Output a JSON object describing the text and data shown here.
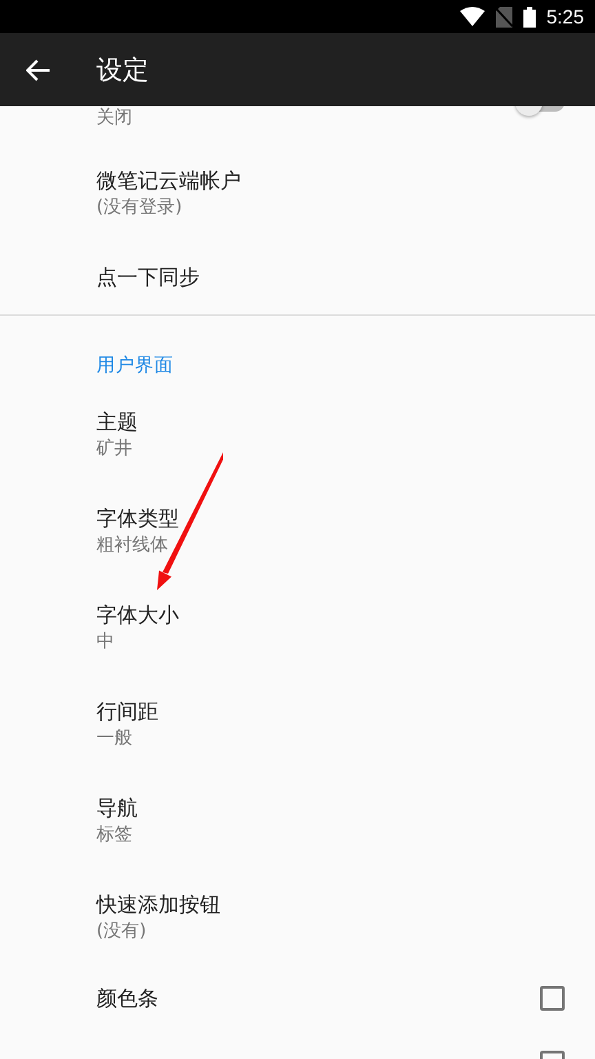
{
  "status_bar": {
    "time": "5:25"
  },
  "app_bar": {
    "title": "设定"
  },
  "preferences": [
    {
      "kind": "switch",
      "summary": "关闭",
      "on": false
    },
    {
      "kind": "text",
      "title": "微笔记云端帐户",
      "summary": "(没有登录)"
    },
    {
      "kind": "text",
      "title": "点一下同步"
    },
    {
      "kind": "divider"
    },
    {
      "kind": "category",
      "title": "用户界面"
    },
    {
      "kind": "text",
      "title": "主题",
      "summary": "矿井"
    },
    {
      "kind": "text",
      "title": "字体类型",
      "summary": "粗衬线体"
    },
    {
      "kind": "text",
      "title": "字体大小",
      "summary": "中"
    },
    {
      "kind": "text",
      "title": "行间距",
      "summary": "一般"
    },
    {
      "kind": "text",
      "title": "导航",
      "summary": "标签"
    },
    {
      "kind": "text",
      "title": "快速添加按钮",
      "summary": "(没有)"
    },
    {
      "kind": "checkbox",
      "title": "颜色条",
      "checked": false
    },
    {
      "kind": "checkbox",
      "checked": false
    }
  ]
}
